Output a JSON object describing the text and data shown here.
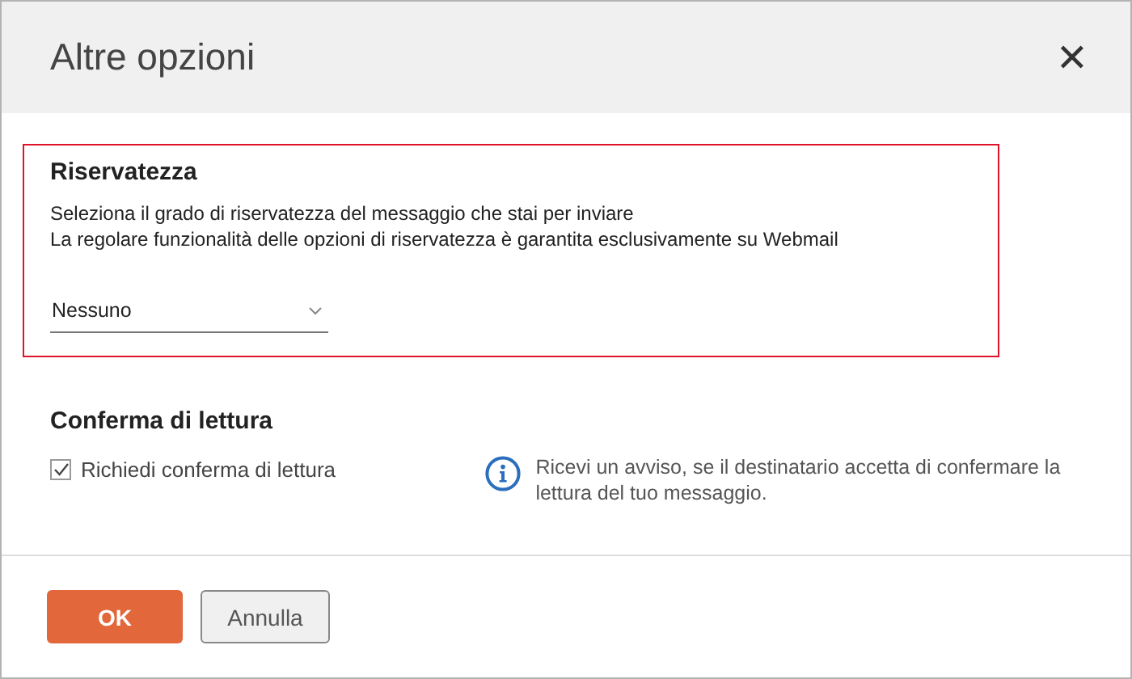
{
  "dialog": {
    "title": "Altre opzioni",
    "close": "✕"
  },
  "privacy": {
    "heading": "Riservatezza",
    "description": [
      "Seleziona il grado di riservatezza del messaggio che stai per inviare",
      "La regolare funzionalità delle opzioni di riservatezza è garantita esclusivamente su Webmail"
    ],
    "select": {
      "value": "Nessuno"
    }
  },
  "read_receipt": {
    "heading": "Conferma di lettura",
    "checkbox": {
      "label": "Richiedi conferma di lettura",
      "checked": true
    },
    "info": "Ricevi un avviso, se il destinatario accetta di confermare la lettura del tuo messaggio."
  },
  "buttons": [
    {
      "label": "OK",
      "kind": "primary"
    },
    {
      "label": "Annulla",
      "kind": "secondary"
    }
  ]
}
